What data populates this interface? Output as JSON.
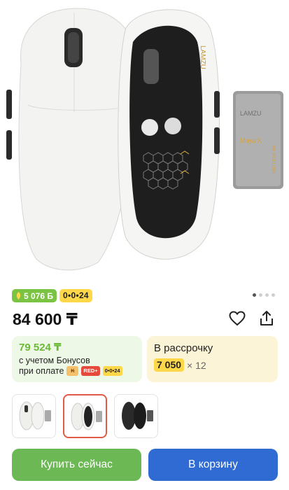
{
  "product": {
    "price": "84 600 ₸",
    "badges": {
      "bonus": "5 076 Б",
      "installment": "0•0•24"
    },
    "image_dots": {
      "count": 4,
      "active": 0
    }
  },
  "bonus_card": {
    "amount": "79 524 ₸",
    "line1": "с учетом Бонусов",
    "line2": "при оплате",
    "chips": [
      "₭",
      "RED+",
      "0•0•24"
    ]
  },
  "installment_card": {
    "title": "В рассрочку",
    "monthly": "7 050",
    "times": "× 12"
  },
  "actions": {
    "buy_now": "Купить сейчас",
    "add_to_cart": "В корзину"
  },
  "hero_logo_text": [
    "LAMZU",
    "LAMZU",
    "Maya X",
    "8K POLLING"
  ],
  "colors": {
    "green": "#6cb854",
    "blue": "#2f6bd3",
    "yellow": "#ffd84a",
    "bonus_green": "#7bc443",
    "selected_border": "#e05b45"
  }
}
